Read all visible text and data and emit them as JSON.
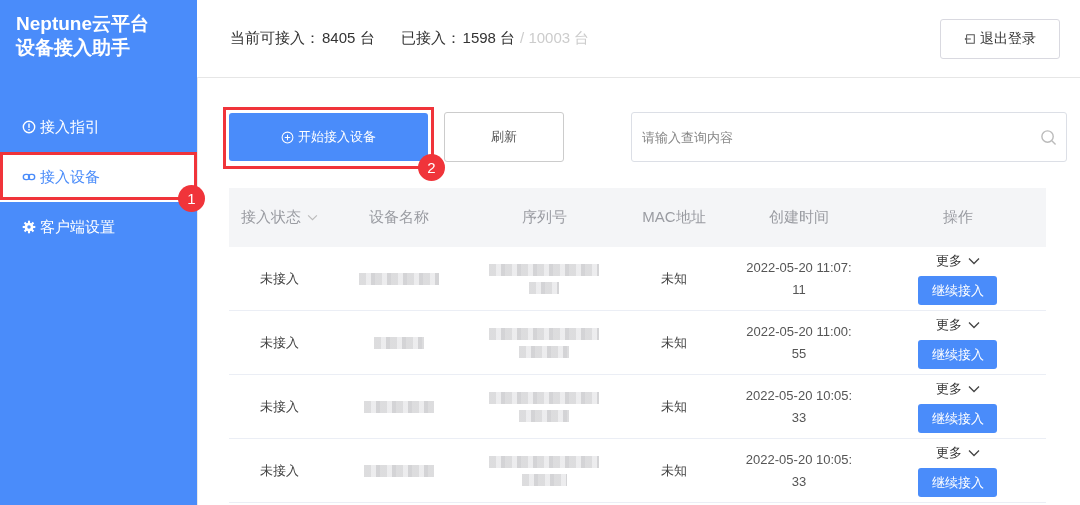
{
  "sidebar": {
    "title_lines": [
      "Neptune云平台",
      "设备接入助手"
    ],
    "items": [
      {
        "label": "接入指引",
        "selected": false
      },
      {
        "label": "接入设备",
        "selected": true,
        "callout": "1"
      },
      {
        "label": "客户端设置",
        "selected": false
      }
    ]
  },
  "header": {
    "stats": [
      {
        "label": "当前可接入：",
        "value": "8405 台"
      },
      {
        "label": "已接入：",
        "value": "1598 台",
        "total": "/ 10003 台"
      }
    ],
    "logout_button": "退出登录"
  },
  "toolbar": {
    "start_button": {
      "label": "开始接入设备",
      "callout": "2"
    },
    "refresh_button": "刷新",
    "search": {
      "placeholder": "请输入查询内容"
    }
  },
  "table": {
    "columns": [
      "接入状态",
      "设备名称",
      "序列号",
      "MAC地址",
      "创建时间",
      "操作"
    ],
    "rows": [
      {
        "status": "未接入",
        "mac": "未知",
        "created": [
          "2022-05-20 11:07:",
          "11"
        ],
        "more": "更多",
        "action": "继续接入"
      },
      {
        "status": "未接入",
        "mac": "未知",
        "created": [
          "2022-05-20 11:00:",
          "55"
        ],
        "more": "更多",
        "action": "继续接入"
      },
      {
        "status": "未接入",
        "mac": "未知",
        "created": [
          "2022-05-20 10:05:",
          "33"
        ],
        "more": "更多",
        "action": "继续接入"
      },
      {
        "status": "未接入",
        "mac": "未知",
        "created": [
          "2022-05-20 10:05:",
          "33"
        ],
        "more": "更多",
        "action": "继续接入"
      }
    ]
  }
}
